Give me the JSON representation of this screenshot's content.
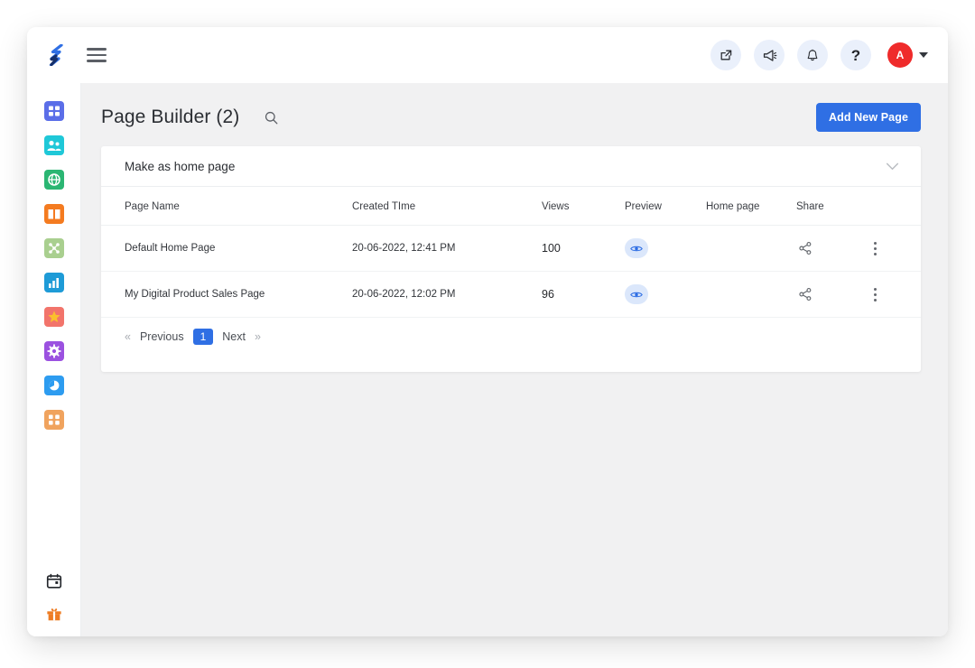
{
  "topbar": {
    "logo_icon": "brand-logo-icon",
    "menu_icon": "hamburger-menu-icon",
    "actions": [
      {
        "name": "external-link-icon",
        "label": ""
      },
      {
        "name": "megaphone-icon",
        "label": ""
      },
      {
        "name": "bell-icon",
        "label": ""
      },
      {
        "name": "help-icon",
        "label": "?"
      }
    ],
    "avatar_initial": "A",
    "avatar_color": "#ef2b2b",
    "caret_icon": "caret-down-icon"
  },
  "sidebar": {
    "items": [
      {
        "name": "sidebar-item-dashboard",
        "icon": "grid-icon",
        "color": "#5b6ee8"
      },
      {
        "name": "sidebar-item-contacts",
        "icon": "contacts-icon",
        "color": "#1fc8d8"
      },
      {
        "name": "sidebar-item-website",
        "icon": "globe-icon",
        "color": "#2bb673"
      },
      {
        "name": "sidebar-item-courses",
        "icon": "book-icon",
        "color": "#f47b20"
      },
      {
        "name": "sidebar-item-automation",
        "icon": "network-icon",
        "color": "#a9cf8f"
      },
      {
        "name": "sidebar-item-analytics",
        "icon": "bar-chart-icon",
        "color": "#1e9bd7"
      },
      {
        "name": "sidebar-item-favorites",
        "icon": "star-icon",
        "color": "#f2746b"
      },
      {
        "name": "sidebar-item-settings",
        "icon": "gear-icon",
        "color": "#9b51e0"
      },
      {
        "name": "sidebar-item-reports",
        "icon": "pie-chart-icon",
        "color": "#2d9cf0"
      },
      {
        "name": "sidebar-item-apps",
        "icon": "apps-icon",
        "color": "#f0a35e"
      }
    ],
    "bottom_items": [
      {
        "name": "sidebar-item-calendar",
        "icon": "calendar-icon",
        "color": "#23262b"
      },
      {
        "name": "sidebar-item-gift",
        "icon": "gift-icon",
        "color": "#ee7c23"
      }
    ]
  },
  "page": {
    "title": "Page Builder (2)",
    "search_icon": "search-icon",
    "add_button_label": "Add New Page",
    "accent_color": "#2f6fe4"
  },
  "accordion": {
    "label": "Make as home page",
    "chevron_icon": "chevron-down-icon"
  },
  "table": {
    "columns": [
      "Page Name",
      "Created TIme",
      "Views",
      "Preview",
      "Home page",
      "Share"
    ],
    "rows": [
      {
        "page_name": "Default Home Page",
        "created_time": "20-06-2022, 12:41 PM",
        "views": "100",
        "preview_icon": "eye-icon",
        "home_page": "",
        "share_icon": "share-icon",
        "menu_icon": "kebab-menu-icon"
      },
      {
        "page_name": "My Digital Product Sales Page",
        "created_time": "20-06-2022, 12:02 PM",
        "views": "96",
        "preview_icon": "eye-icon",
        "home_page": "",
        "share_icon": "share-icon",
        "menu_icon": "kebab-menu-icon"
      }
    ]
  },
  "pagination": {
    "first_label": "«",
    "previous_label": "Previous",
    "current_page": "1",
    "next_label": "Next",
    "last_label": "»"
  }
}
